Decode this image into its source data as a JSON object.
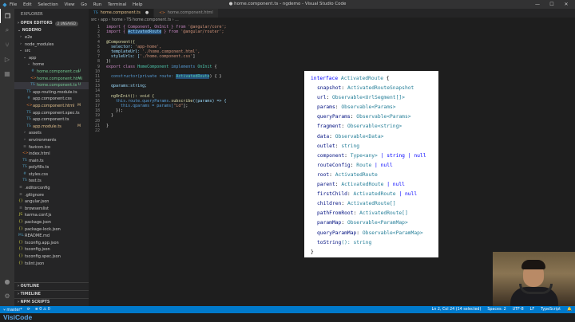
{
  "titlebar": {
    "menu": [
      "File",
      "Edit",
      "Selection",
      "View",
      "Go",
      "Run",
      "Terminal",
      "Help"
    ],
    "title": "● home.component.ts - ngdemo - Visual Studio Code"
  },
  "sidebar": {
    "title": "EXPLORER",
    "open_editors": "OPEN EDITORS",
    "unsaved_badge": "2 UNSAVED",
    "project": "NGDEMO",
    "files": [
      {
        "label": "e2e",
        "kind": "folder",
        "status": ""
      },
      {
        "label": "node_modules",
        "kind": "folder",
        "status": ""
      },
      {
        "label": "src",
        "kind": "folder-open",
        "status": ""
      },
      {
        "label": "app",
        "kind": "folder-open",
        "status": ""
      },
      {
        "label": "home",
        "kind": "folder-open",
        "status": ""
      },
      {
        "label": "home.component.css",
        "kind": "css",
        "status": "U"
      },
      {
        "label": "home.component.html",
        "kind": "html",
        "status": "U"
      },
      {
        "label": "home.component.ts",
        "kind": "ts",
        "status": "U"
      },
      {
        "label": "app-routing.module.ts",
        "kind": "ts",
        "status": ""
      },
      {
        "label": "app.component.css",
        "kind": "css",
        "status": ""
      },
      {
        "label": "app.component.html",
        "kind": "html",
        "status": "M"
      },
      {
        "label": "app.component.spec.ts",
        "kind": "ts",
        "status": ""
      },
      {
        "label": "app.component.ts",
        "kind": "ts",
        "status": ""
      },
      {
        "label": "app.module.ts",
        "kind": "ts",
        "status": "M"
      },
      {
        "label": "assets",
        "kind": "folder",
        "status": ""
      },
      {
        "label": "environments",
        "kind": "folder",
        "status": ""
      },
      {
        "label": "favicon.ico",
        "kind": "file",
        "status": ""
      },
      {
        "label": "index.html",
        "kind": "html",
        "status": ""
      },
      {
        "label": "main.ts",
        "kind": "ts",
        "status": ""
      },
      {
        "label": "polyfills.ts",
        "kind": "ts",
        "status": ""
      },
      {
        "label": "styles.css",
        "kind": "css",
        "status": ""
      },
      {
        "label": "test.ts",
        "kind": "ts",
        "status": ""
      },
      {
        "label": ".editorconfig",
        "kind": "file",
        "status": ""
      },
      {
        "label": ".gitignore",
        "kind": "file",
        "status": ""
      },
      {
        "label": "angular.json",
        "kind": "json",
        "status": ""
      },
      {
        "label": "browserslist",
        "kind": "file",
        "status": ""
      },
      {
        "label": "karma.conf.js",
        "kind": "js",
        "status": ""
      },
      {
        "label": "package.json",
        "kind": "json",
        "status": ""
      },
      {
        "label": "package-lock.json",
        "kind": "json",
        "status": ""
      },
      {
        "label": "README.md",
        "kind": "md",
        "status": ""
      },
      {
        "label": "tsconfig.app.json",
        "kind": "json",
        "status": ""
      },
      {
        "label": "tsconfig.json",
        "kind": "json",
        "status": ""
      },
      {
        "label": "tsconfig.spec.json",
        "kind": "json",
        "status": ""
      },
      {
        "label": "tslint.json",
        "kind": "json",
        "status": ""
      }
    ],
    "outline": "OUTLINE",
    "timeline": "TIMELINE",
    "npm_scripts": "NPM SCRIPTS"
  },
  "tabs": [
    {
      "label": "home.component.ts",
      "close": "●"
    },
    {
      "label": "home.component.html",
      "close": ""
    }
  ],
  "breadcrumb": "src › app › home › TS home.component.ts › ...",
  "code": {
    "l1_a": "import { Component, OnInit } from ",
    "l1_b": "'@angular/core';",
    "l2_a": "import { ",
    "l2_b": "ActivatedRoute",
    "l2_c": " } from ",
    "l2_d": "'@angular/router';",
    "l4": "@Component({",
    "l5_a": "  selector: ",
    "l5_b": "'app-home',",
    "l6_a": "  templateUrl: ",
    "l6_b": "'./home.component.html',",
    "l7_a": "  styleUrls: [",
    "l7_b": "'./home.component.css'",
    "l7_c": "]",
    "l8": "})",
    "l9_a": "export class ",
    "l9_b": "HomeComponent",
    "l9_c": " implements ",
    "l9_d": "OnInit",
    "l9_e": " {",
    "l11_a": "  constructor(private route: ",
    "l11_b": "ActivatedRoute",
    "l11_c": ") { }",
    "l13": "  qparams:string;",
    "l15": "  ngOnInit(): void {",
    "l16_a": "    this.route.queryParams.",
    "l16_b": "subscribe",
    "l16_c": "((params) => {",
    "l17_a": "      this.qparams = params[",
    "l17_b": "\"id\"",
    "l17_c": "];",
    "l18": "    });",
    "l19": "  }",
    "l21": "}"
  },
  "popup": {
    "header_kw": "interface",
    "header_name": "ActivatedRoute",
    "lines": [
      {
        "prop": "snapshot",
        "type": "ActivatedRouteSnapshot",
        "extra": ""
      },
      {
        "prop": "url",
        "type": "Observable<UrlSegment[]>",
        "extra": ""
      },
      {
        "prop": "params",
        "type": "Observable<Params>",
        "extra": ""
      },
      {
        "prop": "queryParams",
        "type": "Observable<Params>",
        "extra": ""
      },
      {
        "prop": "fragment",
        "type": "Observable<string>",
        "extra": ""
      },
      {
        "prop": "data",
        "type": "Observable<Data>",
        "extra": ""
      },
      {
        "prop": "outlet",
        "type": "string",
        "extra": ""
      },
      {
        "prop": "component",
        "type": "Type<any>",
        "extra": " | string | null"
      },
      {
        "prop": "routeConfig",
        "type": "Route",
        "extra": " | null"
      },
      {
        "prop": "root",
        "type": "ActivatedRoute",
        "extra": ""
      },
      {
        "prop": "parent",
        "type": "ActivatedRoute",
        "extra": " | null"
      },
      {
        "prop": "firstChild",
        "type": "ActivatedRoute",
        "extra": " | null"
      },
      {
        "prop": "children",
        "type": "ActivatedRoute[]",
        "extra": ""
      },
      {
        "prop": "pathFromRoot",
        "type": "ActivatedRoute[]",
        "extra": ""
      },
      {
        "prop": "paramMap",
        "type": "Observable<ParamMap>",
        "extra": ""
      },
      {
        "prop": "queryParamMap",
        "type": "Observable<ParamMap>",
        "extra": ""
      },
      {
        "prop": "toString",
        "type": "(): string",
        "extra": ""
      }
    ],
    "close": "}"
  },
  "statusbar": {
    "branch": "master*",
    "sync": "⟳",
    "errors": "⊗ 0 ⚠ 0",
    "position": "Ln 2, Col 24 (14 selected)",
    "spaces": "Spaces: 2",
    "encoding": "UTF-8",
    "eol": "LF",
    "language": "TypeScript"
  },
  "brand": "VisiCode",
  "colors": {
    "accent": "#007acc",
    "modified": "#e2c08d",
    "untracked": "#73c991"
  }
}
